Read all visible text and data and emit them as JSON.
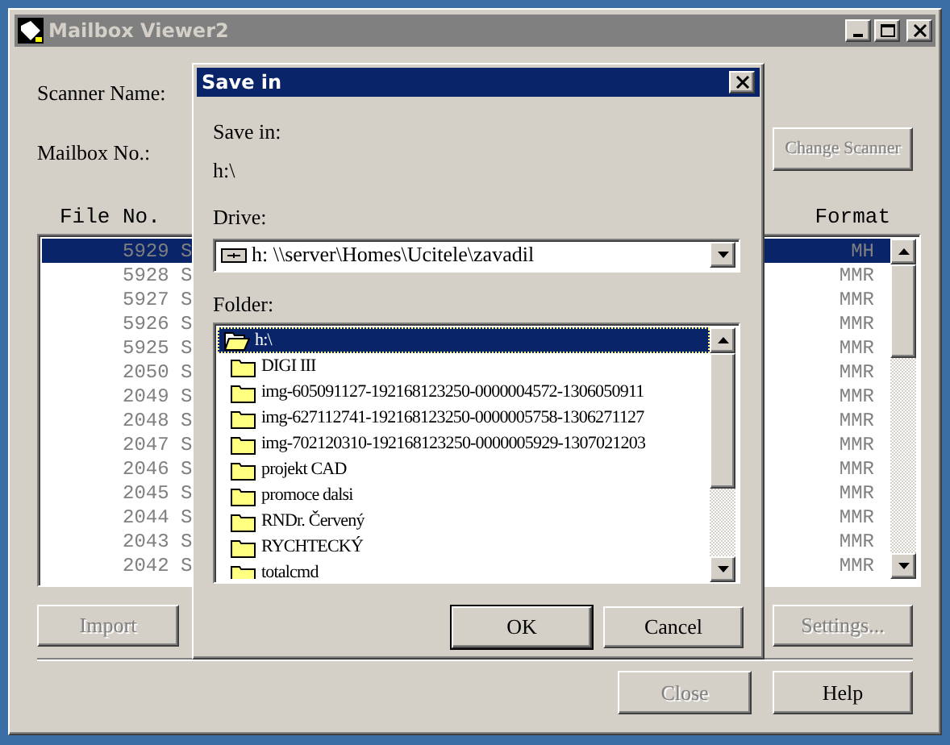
{
  "window": {
    "title": "Mailbox Viewer2",
    "active": false
  },
  "labels": {
    "scanner_name": "Scanner Name:",
    "mailbox_no": "Mailbox No.:"
  },
  "change_scanner": {
    "label": "Change Scanner",
    "disabled": true
  },
  "list": {
    "columns": [
      "File No.",
      "Format"
    ],
    "rows": [
      {
        "file_no": "5929 S",
        "format": "MH",
        "selected": true
      },
      {
        "file_no": "5928 S",
        "format": "MMR",
        "selected": false
      },
      {
        "file_no": "5927 S",
        "format": "MMR",
        "selected": false
      },
      {
        "file_no": "5926 S",
        "format": "MMR",
        "selected": false
      },
      {
        "file_no": "5925 S",
        "format": "MMR",
        "selected": false
      },
      {
        "file_no": "2050 S",
        "format": "MMR",
        "selected": false
      },
      {
        "file_no": "2049 S",
        "format": "MMR",
        "selected": false
      },
      {
        "file_no": "2048 S",
        "format": "MMR",
        "selected": false
      },
      {
        "file_no": "2047 S",
        "format": "MMR",
        "selected": false
      },
      {
        "file_no": "2046 S",
        "format": "MMR",
        "selected": false
      },
      {
        "file_no": "2045 S",
        "format": "MMR",
        "selected": false
      },
      {
        "file_no": "2044 S",
        "format": "MMR",
        "selected": false
      },
      {
        "file_no": "2043 S",
        "format": "MMR",
        "selected": false
      },
      {
        "file_no": "2042 S",
        "format": "MMR",
        "selected": false
      }
    ]
  },
  "import": {
    "label": "Import",
    "disabled": true
  },
  "settings": {
    "label": "Settings...",
    "disabled": true
  },
  "close": {
    "label": "Close",
    "disabled": true
  },
  "help": {
    "label": "Help",
    "disabled": false
  },
  "dialog": {
    "title": "Save in",
    "save_in_label": "Save in:",
    "save_in_value": "h:\\",
    "drive_label": "Drive:",
    "drive_value": "h: \\\\server\\Homes\\Ucitele\\zavadil",
    "folder_label": "Folder:",
    "folders": [
      {
        "name": "h:\\",
        "open": true,
        "selected": true
      },
      {
        "name": "DIGI III",
        "open": false,
        "selected": false
      },
      {
        "name": "img-605091127-192168123250-0000004572-1306050911",
        "open": false,
        "selected": false
      },
      {
        "name": "img-627112741-192168123250-0000005758-1306271127",
        "open": false,
        "selected": false
      },
      {
        "name": "img-702120310-192168123250-0000005929-1307021203",
        "open": false,
        "selected": false
      },
      {
        "name": "projekt CAD",
        "open": false,
        "selected": false
      },
      {
        "name": "promoce dalsi",
        "open": false,
        "selected": false
      },
      {
        "name": "RNDr. Červený",
        "open": false,
        "selected": false
      },
      {
        "name": "RYCHTECKÝ",
        "open": false,
        "selected": false
      },
      {
        "name": "totalcmd",
        "open": false,
        "selected": false
      }
    ],
    "buttons": [
      "OK",
      "Cancel"
    ]
  }
}
